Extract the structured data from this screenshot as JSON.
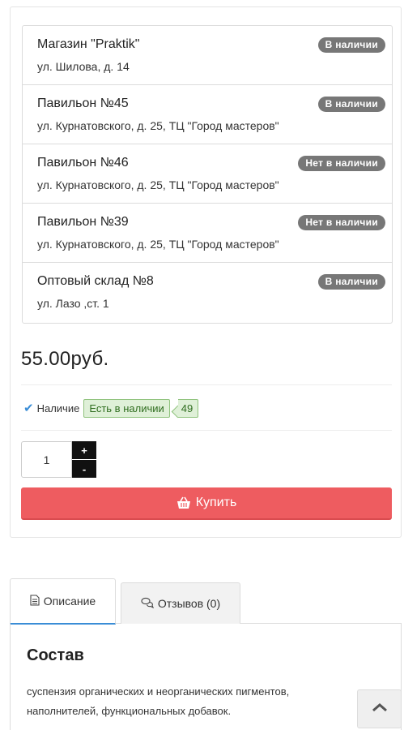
{
  "stores": [
    {
      "name": "Магазин \"Praktik\"",
      "address": "ул. Шилова, д. 14",
      "status": "В наличии"
    },
    {
      "name": "Павильон №45",
      "address": "ул. Курнатовского, д. 25, ТЦ \"Город мастеров\"",
      "status": "В наличии"
    },
    {
      "name": "Павильон №46",
      "address": "ул. Курнатовского, д. 25, ТЦ \"Город мастеров\"",
      "status": "Нет в наличии"
    },
    {
      "name": "Павильон №39",
      "address": "ул. Курнатовского, д. 25, ТЦ \"Город мастеров\"",
      "status": "Нет в наличии"
    },
    {
      "name": "Оптовый склад №8",
      "address": "ул. Лазо ,ст. 1",
      "status": "В наличии"
    }
  ],
  "product": {
    "price": "55.00руб.",
    "availability_label": "Наличие",
    "availability_status": "Есть в наличии",
    "availability_count": "49",
    "quantity": "1",
    "plus": "+",
    "minus": "-",
    "buy_label": "Купить"
  },
  "tabs": {
    "description": "Описание",
    "reviews": "Отзывов (0)"
  },
  "description": {
    "title": "Состав",
    "text": "суспензия органических и неорганических пигментов, наполнителей, функциональных добавок."
  },
  "icons": {
    "check": "check-icon",
    "basket": "basket-icon",
    "document": "document-icon",
    "comments": "comments-icon",
    "scroll_top": "chevron-up-icon"
  },
  "colors": {
    "buy_button": "#ee5c60",
    "badge": "#777777",
    "available_bg": "#dff0d8",
    "accent": "#3a8dd6"
  }
}
